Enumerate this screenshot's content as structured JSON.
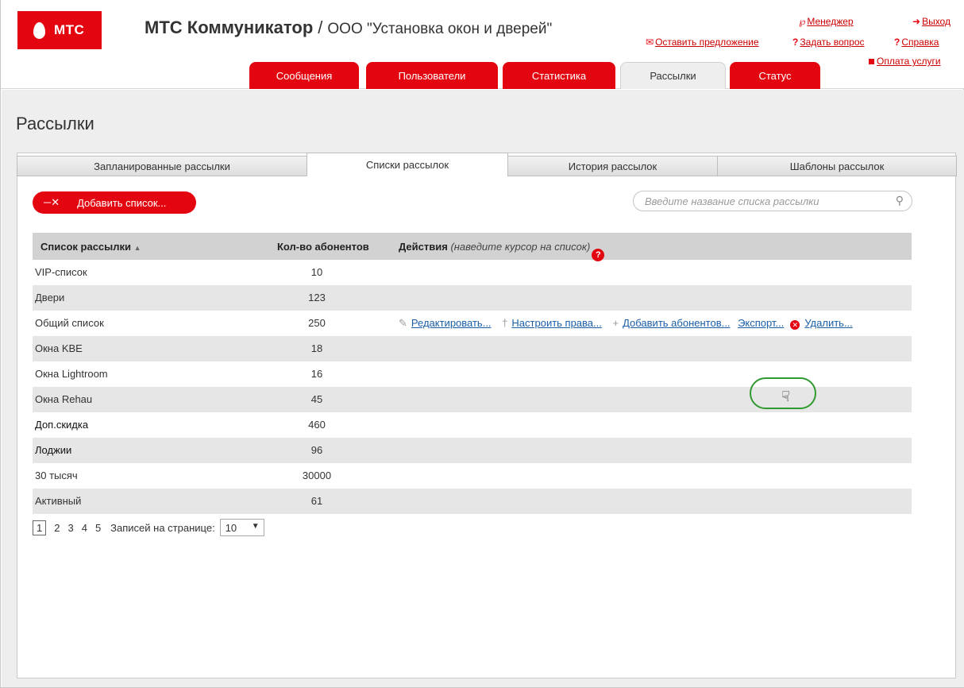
{
  "brand": {
    "logo_text": "МТС",
    "accent": "#e30611"
  },
  "header": {
    "app_name": "МТС Коммуникатор",
    "separator": "/",
    "company": "ООО \"Установка окон и дверей\"",
    "links": {
      "manager": "Менеджер",
      "logout": "Выход",
      "suggest": "Оставить предложение",
      "ask": "Задать вопрос",
      "help": "Справка",
      "payment": "Оплата услуги"
    }
  },
  "main_tabs": [
    {
      "label": "Сообщения"
    },
    {
      "label": "Пользователи"
    },
    {
      "label": "Статистика"
    },
    {
      "label": "Рассылки",
      "active": true
    },
    {
      "label": "Статус"
    }
  ],
  "page": {
    "title": "Рассылки"
  },
  "sub_tabs": [
    {
      "label": "Запланированные рассылки"
    },
    {
      "label": "Списки рассылок",
      "active": true
    },
    {
      "label": "История рассылок"
    },
    {
      "label": "Шаблоны рассылок"
    }
  ],
  "toolbar": {
    "add_label": "Добавить список...",
    "search_placeholder": "Введите название списка рассылки"
  },
  "table": {
    "headers": {
      "name": "Список рассылки",
      "sort_indicator": "▲",
      "count": "Кол-во абонентов",
      "actions": "Действия",
      "actions_hint": "(наведите курсор на список)",
      "help_icon": "?"
    },
    "rows": [
      {
        "name": "VIP-список",
        "count": "10"
      },
      {
        "name": "Двери",
        "count": "123"
      },
      {
        "name": "Общий список",
        "count": "250"
      },
      {
        "name": "Окна KBE",
        "count": "18"
      },
      {
        "name": "Окна Lightroom",
        "count": "16"
      },
      {
        "name": "Окна Rehau",
        "count": "45"
      },
      {
        "name": "Доп.скидка",
        "count": "460"
      },
      {
        "name": "Лоджии",
        "count": "96"
      },
      {
        "name": "30 тысяч",
        "count": "30000"
      },
      {
        "name": "Активный",
        "count": "61"
      }
    ],
    "hover_actions": {
      "edit": "Редактировать...",
      "rights": "Настроить права...",
      "add_subscribers": "Добавить абонентов...",
      "export": "Экспорт...",
      "delete": "Удалить..."
    }
  },
  "pager": {
    "pages": [
      "1",
      "2",
      "3",
      "4",
      "5"
    ],
    "current": "1",
    "per_page_label": "Записей на странице:",
    "per_page_value": "10"
  }
}
